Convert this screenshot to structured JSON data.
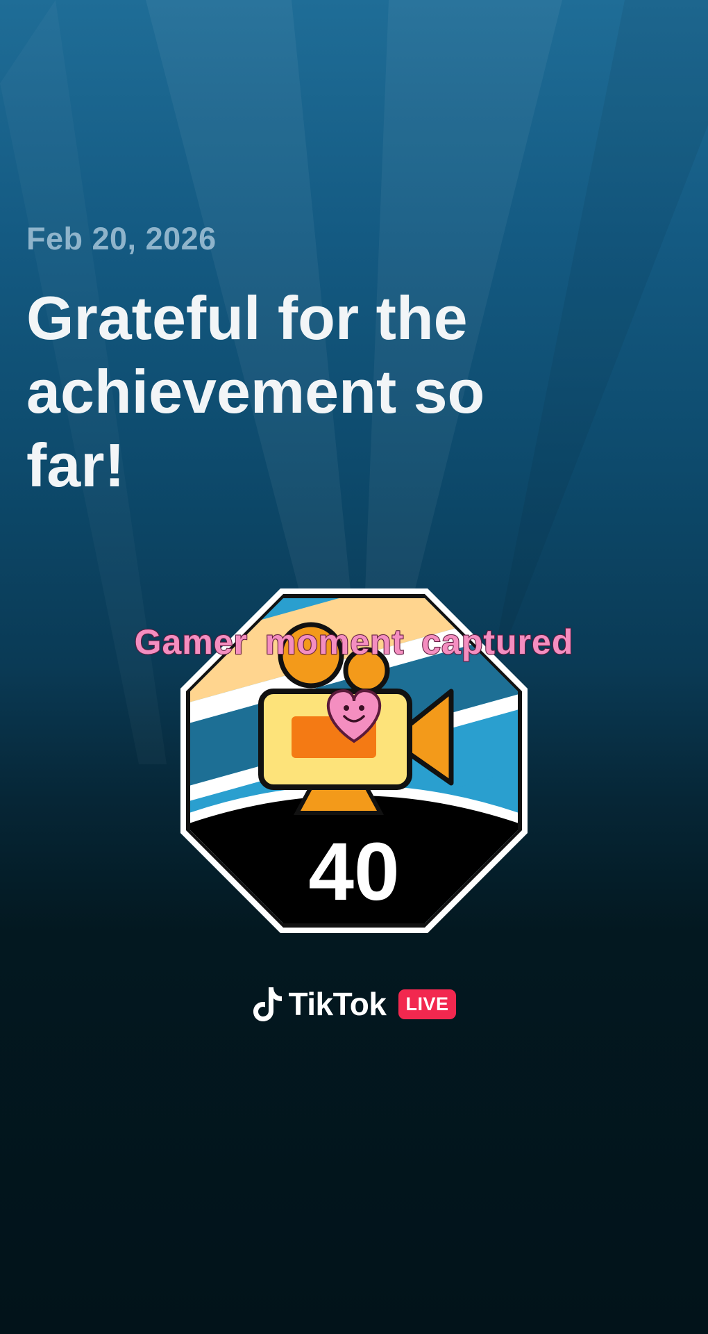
{
  "post": {
    "date": "Feb 20, 2026",
    "headline": "Grateful for the achievement so far!"
  },
  "badge": {
    "title": "Gamer moment captured",
    "number": "40",
    "icon": "video-camera-heart-icon",
    "colors": {
      "camera_body": "#fde37a",
      "camera_accent": "#f28a16",
      "heart": "#f48ec0",
      "stripe_blue": "#2a9fcf",
      "stripe_dark": "#1d6f95",
      "stripe_peach": "#ffd58f",
      "base": "#000000"
    }
  },
  "brand": {
    "name": "TikTok",
    "live_label": "LIVE",
    "icon": "tiktok-note-icon",
    "live_color": "#f2284f"
  }
}
